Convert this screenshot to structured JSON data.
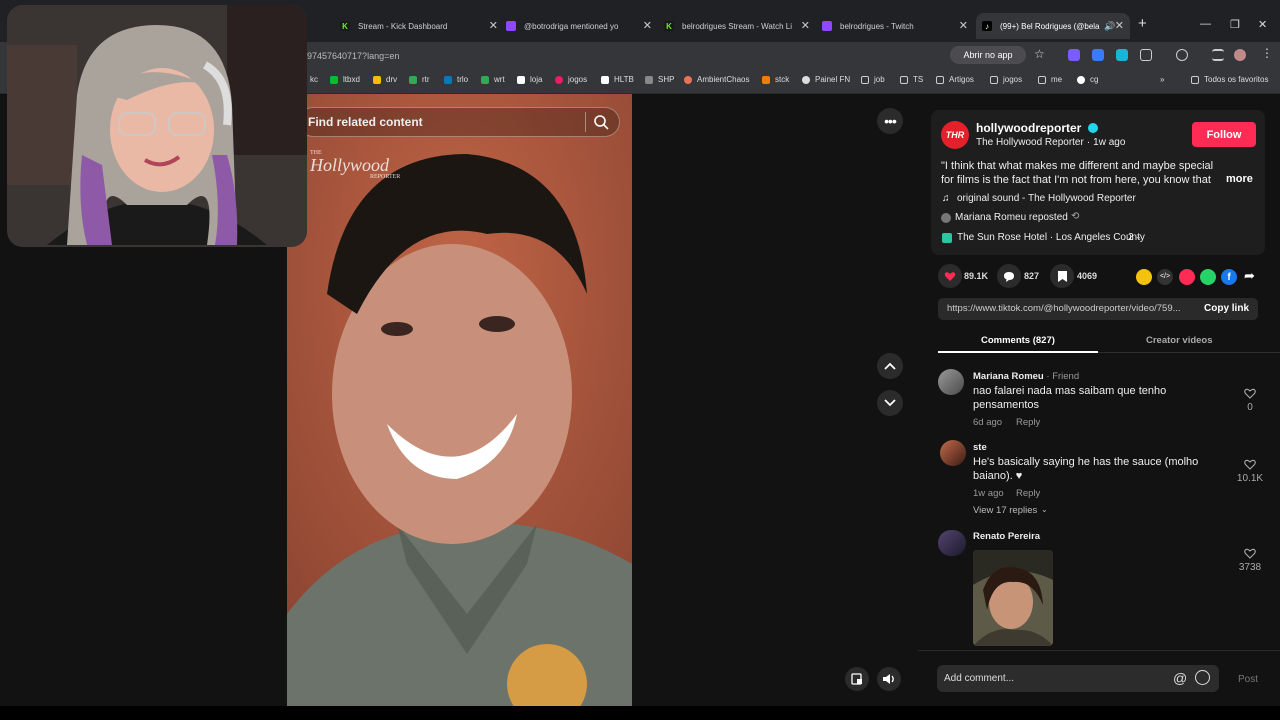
{
  "browser": {
    "tabs": [
      {
        "label": "Stream - Kick Dashboard",
        "icon": "kick-icon",
        "color": "#53fc18"
      },
      {
        "label": "@botrodriga mentioned yo",
        "icon": "twitch-icon",
        "color": "#9146ff"
      },
      {
        "label": "belrodrigues Stream - Watch Li",
        "icon": "kick-icon",
        "color": "#53fc18"
      },
      {
        "label": "belrodrigues - Twitch",
        "icon": "twitch-icon",
        "color": "#9146ff"
      },
      {
        "label": "(99+) Bel Rodrigues (@bela",
        "icon": "tiktok-icon",
        "color": "#ffffff"
      }
    ],
    "url": "97457640717?lang=en",
    "open_app": "Abrir no app",
    "bookmarks": [
      "kc",
      "ltbxd",
      "drv",
      "rtr",
      "trlo",
      "wrt",
      "loja",
      "jogos",
      "HLTB",
      "SHP",
      "AmbientChaos",
      "stck",
      "Painel FN",
      "job",
      "TS",
      "Artigos",
      "jogos",
      "me",
      "cg"
    ],
    "all_favorites": "Todos os favoritos"
  },
  "video": {
    "search_placeholder": "Find related content",
    "watermark_top": "THE",
    "watermark": "Hollywood",
    "watermark_bottom": "REPORTER"
  },
  "post": {
    "username": "hollywoodreporter",
    "display_name": "The Hollywood Reporter",
    "time": "1w ago",
    "follow": "Follow",
    "caption": "\"I think that what makes me different and maybe special for films is the fact that I'm not from here, you know that I...",
    "more": "more",
    "sound": "original sound - The Hollywood Reporter",
    "repost": "Mariana Romeu reposted",
    "location": "The Sun Rose Hotel · Los Angeles County",
    "location_count": "2",
    "likes": "89.1K",
    "comments": "827",
    "saves": "4069",
    "link": "https://www.tiktok.com/@hollywoodreporter/video/759...",
    "copy_link": "Copy link"
  },
  "tabs": {
    "comments": "Comments (827)",
    "creator": "Creator videos"
  },
  "comments": [
    {
      "name": "Mariana Romeu",
      "tag": " · Friend",
      "text1": "nao falarei nada mas saibam que tenho",
      "text2": "pensamentos",
      "time": "6d ago",
      "reply": "Reply",
      "likes": "0"
    },
    {
      "name": "ste",
      "tag": "",
      "text1": "He's basically saying he has the sauce (molho",
      "text2": "baiano). ♥",
      "time": "1w ago",
      "reply": "Reply",
      "likes": "10.1K",
      "view_replies": "View 17 replies"
    },
    {
      "name": "Renato Pereira",
      "tag": "",
      "likes": "3738"
    }
  ],
  "add_comment": "Add comment...",
  "post_button": "Post",
  "colors": {
    "accent": "#fe2c55",
    "bg": "#121212",
    "panel": "#1e1e1e"
  }
}
